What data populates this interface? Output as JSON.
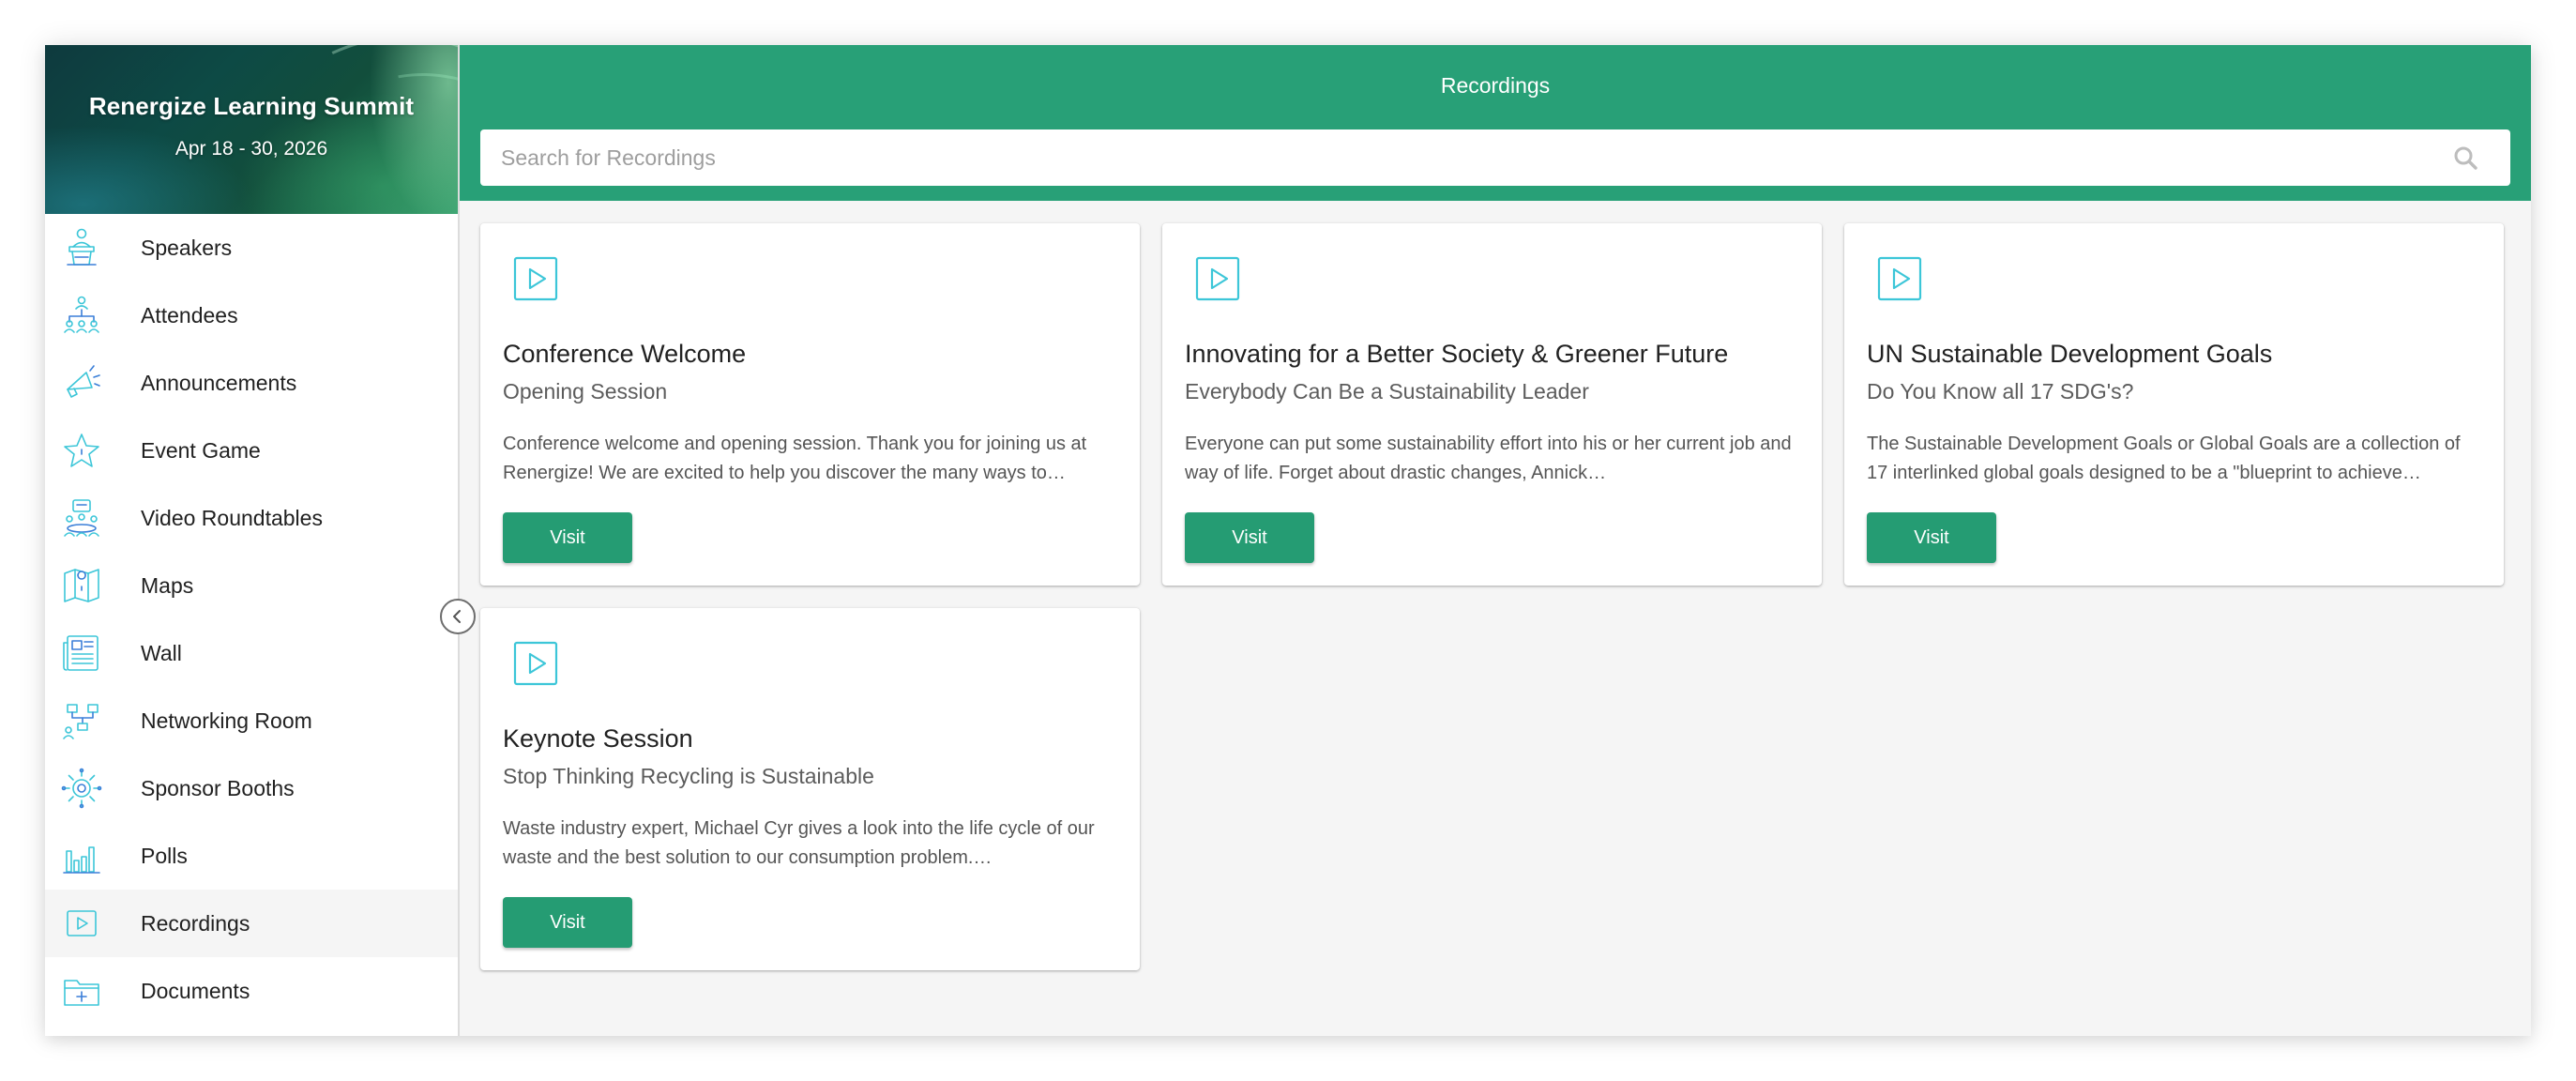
{
  "colors": {
    "brand_green": "#28a077",
    "button_green": "#259c73",
    "icon_cyan": "#3cc6d8",
    "icon_blue": "#3b7fd8"
  },
  "event": {
    "title": "Renergize Learning Summit",
    "dates": "Apr 18 - 30, 2026"
  },
  "sidebar": {
    "items": [
      {
        "label": "Speakers",
        "icon": "podium-icon"
      },
      {
        "label": "Attendees",
        "icon": "people-network-icon"
      },
      {
        "label": "Announcements",
        "icon": "megaphone-icon"
      },
      {
        "label": "Event Game",
        "icon": "star-icon"
      },
      {
        "label": "Video Roundtables",
        "icon": "roundtable-icon"
      },
      {
        "label": "Maps",
        "icon": "map-icon"
      },
      {
        "label": "Wall",
        "icon": "newspaper-icon"
      },
      {
        "label": "Networking Room",
        "icon": "networking-icon"
      },
      {
        "label": "Sponsor Booths",
        "icon": "sponsor-icon"
      },
      {
        "label": "Polls",
        "icon": "bar-chart-icon"
      },
      {
        "label": "Recordings",
        "icon": "play-icon",
        "active": true
      },
      {
        "label": "Documents",
        "icon": "folder-icon"
      }
    ],
    "collapse_icon": "chevron-left-icon"
  },
  "header": {
    "title": "Recordings"
  },
  "search": {
    "placeholder": "Search for Recordings",
    "value": "",
    "icon": "search-icon"
  },
  "recordings": [
    {
      "title": "Conference Welcome",
      "subtitle": "Opening Session",
      "description": "Conference welcome and opening session. Thank you for joining us at Renergize! We are excited to help you discover the many ways to…",
      "button": "Visit",
      "icon": "play-icon"
    },
    {
      "title": "Innovating for a Better Society & Greener Future",
      "subtitle": "Everybody Can Be a Sustainability Leader",
      "description": "Everyone can put some sustainability effort into his or her current job and way of life. Forget about drastic changes, Annick…",
      "button": "Visit",
      "icon": "play-icon"
    },
    {
      "title": "UN Sustainable Development Goals",
      "subtitle": "Do You Know all 17 SDG's?",
      "description": "The Sustainable Development Goals or Global Goals are a collection of 17 interlinked global goals designed to be a \"blueprint to achieve…",
      "button": "Visit",
      "icon": "play-icon"
    },
    {
      "title": "Keynote Session",
      "subtitle": "Stop Thinking Recycling is Sustainable",
      "description": "Waste industry expert, Michael Cyr gives a look into the life cycle of our waste and the best solution to our consumption problem.…",
      "button": "Visit",
      "icon": "play-icon"
    }
  ]
}
